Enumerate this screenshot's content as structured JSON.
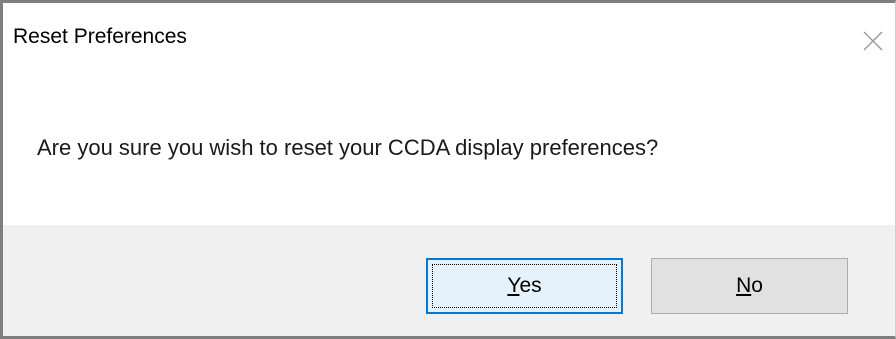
{
  "dialog": {
    "title": "Reset Preferences",
    "message": "Are you sure you wish to reset your CCDA display preferences?",
    "buttons": {
      "yes": {
        "accel": "Y",
        "rest": "es"
      },
      "no": {
        "accel": "N",
        "rest": "o"
      }
    },
    "colors": {
      "focus_border": "#0078d7",
      "button_bar": "#f0f0f0",
      "button_face": "#e1e1e1"
    },
    "icons": {
      "close": "close-icon"
    }
  }
}
